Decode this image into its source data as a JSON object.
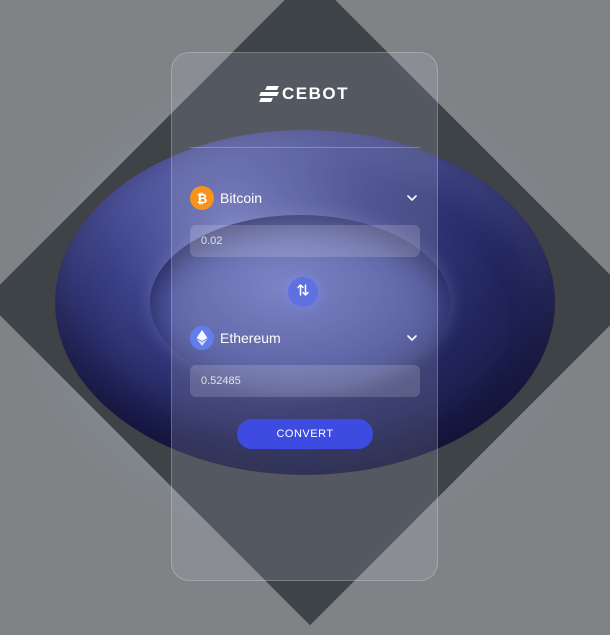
{
  "brand": {
    "name": "CEBOT"
  },
  "from": {
    "coin": "Bitcoin",
    "icon": "bitcoin-icon",
    "icon_glyph": "₿",
    "icon_color": "#f7931a",
    "amount": "0.02"
  },
  "to": {
    "coin": "Ethereum",
    "icon": "ethereum-icon",
    "icon_color": "#627eea",
    "amount": "0.52485"
  },
  "swap": {
    "icon": "swap-arrows-icon"
  },
  "actions": {
    "convert_label": "CONVERT"
  },
  "colors": {
    "accent": "#3d4be0",
    "swap_button": "#5f70e0",
    "background": "#7f8386"
  }
}
